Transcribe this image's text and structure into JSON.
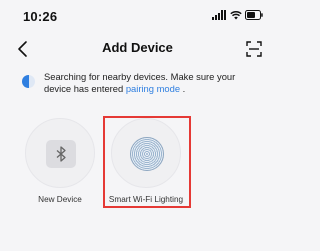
{
  "status_bar": {
    "time": "10:26"
  },
  "nav": {
    "title": "Add Device"
  },
  "notice": {
    "text_before": "Searching for nearby devices. Make sure your device has entered ",
    "link": "pairing mode",
    "text_after": " ."
  },
  "devices": [
    {
      "label": "New Device",
      "icon": "bluetooth-icon"
    },
    {
      "label": "Smart Wi-Fi Lighting",
      "icon": "wifi-light-icon"
    }
  ],
  "colors": {
    "accent": "#2f7fe0",
    "highlight": "#e53935",
    "background": "#f5f5f7"
  }
}
